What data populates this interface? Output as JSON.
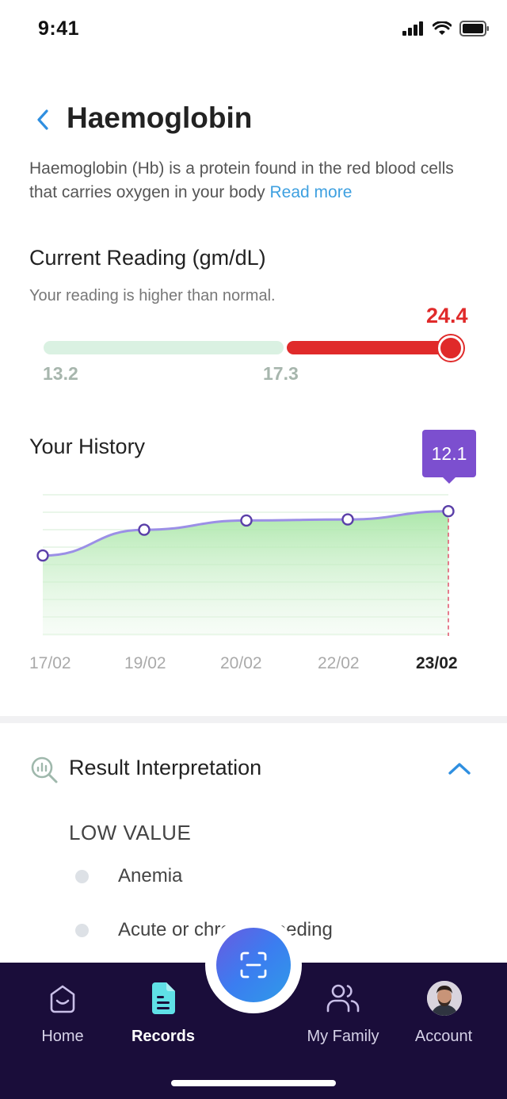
{
  "status_bar": {
    "time": "9:41"
  },
  "header": {
    "title": "Haemoglobin"
  },
  "description": {
    "text": "Haemoglobin (Hb) is a protein found in the red blood cells that carries oxygen in your body ",
    "link": "Read more"
  },
  "current_reading": {
    "title": "Current Reading (gm/dL)",
    "subtitle": "Your reading is higher than normal.",
    "value": "24.4",
    "normal_low": "13.2",
    "normal_high": "17.3"
  },
  "history": {
    "title": "Your History",
    "tooltip": "12.1",
    "x_labels": [
      "17/02",
      "19/02",
      "20/02",
      "22/02",
      "23/02"
    ]
  },
  "chart_data": {
    "type": "area",
    "x": [
      "17/02",
      "19/02",
      "20/02",
      "22/02",
      "23/02"
    ],
    "series": [
      {
        "values": [
          7.8,
          10.3,
          11.2,
          11.3,
          12.1
        ]
      }
    ],
    "highlight": {
      "x": "23/02",
      "label": "12.1"
    },
    "ylim": [
      0,
      14
    ],
    "grid": true,
    "colors": {
      "line": "#9b8fe6",
      "fill": "#a8e6a6",
      "point_stroke": "#5a3fa8",
      "highlight_line": "#e0506a"
    }
  },
  "interpretation": {
    "title": "Result Interpretation",
    "low_title": "LOW VALUE",
    "items": [
      "Anemia",
      "Acute or chronic bleeding"
    ]
  },
  "nav": {
    "items": [
      {
        "label": "Home",
        "icon": "home-icon"
      },
      {
        "label": "Records",
        "icon": "records-icon"
      },
      {
        "label": "My Family",
        "icon": "family-icon"
      },
      {
        "label": "Account",
        "icon": "avatar"
      }
    ],
    "scan_icon": "scan-icon"
  },
  "colors": {
    "accent": "#3ea0e0",
    "alert": "#e02a2a",
    "tooltip": "#7c4fcf",
    "nav_bg": "#1a0d3a",
    "records_icon": "#5fe0e6"
  }
}
